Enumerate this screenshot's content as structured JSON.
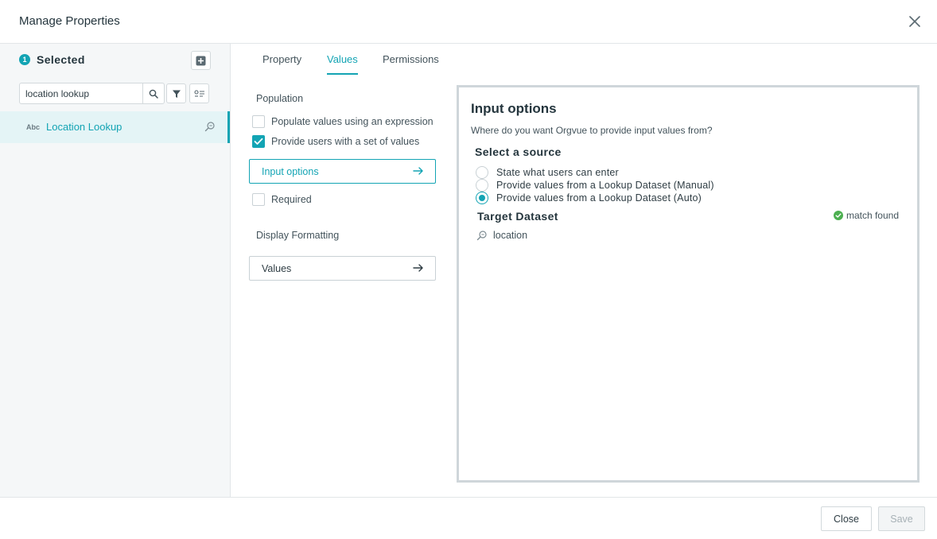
{
  "dialog": {
    "title": "Manage Properties"
  },
  "sidebar": {
    "selected_count": "1",
    "selected_label": "Selected",
    "search": {
      "value": "location lookup",
      "placeholder": ""
    },
    "items": [
      {
        "type_label": "Abc",
        "label": "Location Lookup",
        "icon": "lookup-icon"
      }
    ]
  },
  "tabs": [
    {
      "label": "Property",
      "active": false
    },
    {
      "label": "Values",
      "active": true
    },
    {
      "label": "Permissions",
      "active": false
    }
  ],
  "middle": {
    "population_label": "Population",
    "populate_expression_label": "Populate values using an expression",
    "populate_expression_checked": false,
    "provide_set_label": "Provide users with a set of values",
    "provide_set_checked": true,
    "input_options_label": "Input options",
    "required_label": "Required",
    "required_checked": false,
    "display_formatting_label": "Display Formatting",
    "values_label": "Values"
  },
  "panel": {
    "title": "Input options",
    "question": "Where do you want Orgvue to provide input values from?",
    "source_title": "Select a source",
    "sources": [
      {
        "label": "State what users can enter",
        "selected": false
      },
      {
        "label": "Provide values from a Lookup Dataset (Manual)",
        "selected": false
      },
      {
        "label": "Provide values from a Lookup Dataset (Auto)",
        "selected": true
      }
    ],
    "target_title": "Target Dataset",
    "match_status": "match found",
    "target_value": "location"
  },
  "footer": {
    "close_label": "Close",
    "save_label": "Save"
  },
  "colors": {
    "accent": "#13a4b4",
    "success": "#4caf50",
    "text": "#2f3d44"
  }
}
